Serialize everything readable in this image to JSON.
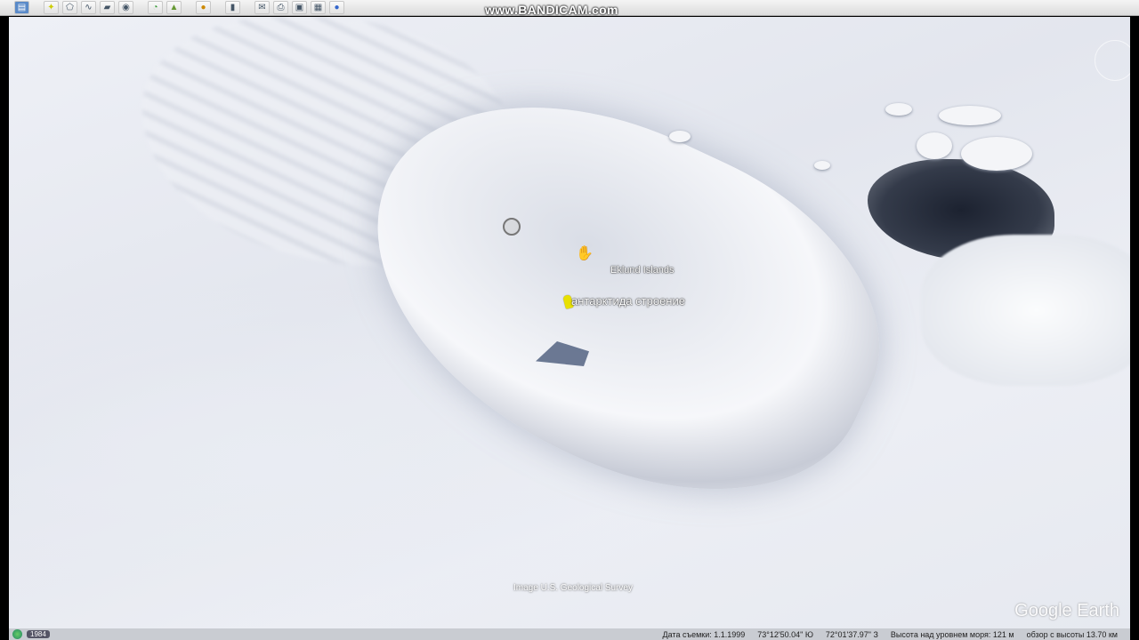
{
  "toolbar": {
    "icons": [
      "sidebar-icon",
      "placemark-icon",
      "polygon-icon",
      "path-icon",
      "overlay-icon",
      "tour-icon",
      "history-icon",
      "sunlight-icon",
      "planet-icon",
      "ruler-icon",
      "email-icon",
      "print-icon",
      "map-save-icon",
      "image-icon",
      "globe-icon"
    ]
  },
  "watermark": "www.BANDICAM.com",
  "map": {
    "place_label": "Eklund Islands",
    "placemark_label": "антарктида строение",
    "credit": "Image U.S. Geological Survey",
    "logo": "Google Earth"
  },
  "status": {
    "year": "1984",
    "date": "Дата съемки: 1.1.1999",
    "lat": "73°12'50.04\" Ю",
    "lon": "72°01'37.97\" З",
    "elev": "Высота над уровнем моря:  121 м",
    "eye": "обзор с высоты  13.70 км"
  }
}
